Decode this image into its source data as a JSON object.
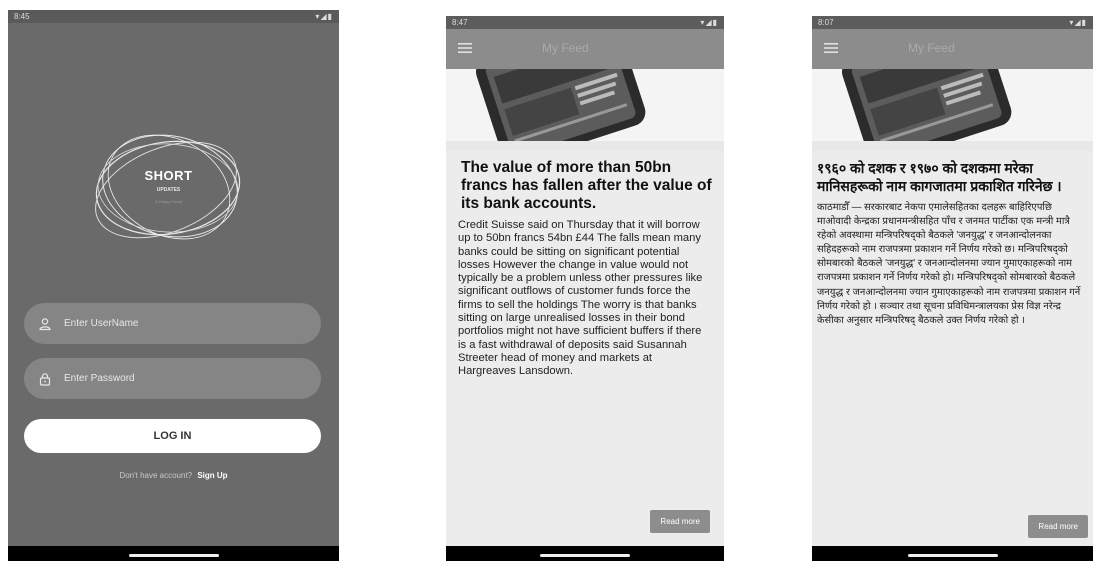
{
  "login": {
    "status_time": "8:45",
    "logo_title": "SHORT",
    "logo_subtitle": "UPDATES",
    "logo_tagline": "A Happy Portal",
    "username_placeholder": "Enter UserName",
    "password_placeholder": "Enter Password",
    "login_label": "LOG IN",
    "signup_prompt": "Don't have account?",
    "signup_link": "Sign Up"
  },
  "feed_english": {
    "status_time": "8:47",
    "app_title": "My Feed",
    "headline": "The value of more than 50bn francs has fallen after the value of its bank accounts.",
    "body": "Credit Suisse said on Thursday that it will borrow up to 50bn francs 54bn £44 The falls mean many banks could be sitting on significant potential losses However the change in value would not typically be a problem unless other pressures like significant outflows of customer funds force the firms to sell the holdings The worry is that banks sitting on large unrealised losses in their bond portfolios might not have sufficient buffers if there is a fast withdrawal of deposits said Susannah Streeter head of money and markets at Hargreaves Lansdown.",
    "read_more": "Read more"
  },
  "feed_nepali": {
    "status_time": "8:07",
    "app_title": "My Feed",
    "headline": "१९६० को दशक र १९७० को दशकमा मरेका मानिसहरूको नाम कागजातमा प्रकाशित गरिनेछ ।",
    "body": "काठमाडौँ — सरकारबाट नेकपा एमालेसहितका दलहरू बाहिरिएपछि माओवादी केन्द्रका प्रधानमन्त्रीसहित पाँच र जनमत पार्टीका एक मन्त्री मात्रै रहेको अवस्थामा मन्त्रिपरिषद्को बैठकले 'जनयुद्ध' र जनआन्दोलनका सहिदहरूको नाम राजपत्रमा प्रकाशन गर्ने निर्णय गरेको छ। मन्त्रिपरिषद्को सोमबारको बैठकले 'जनयुद्ध' र जनआन्दोलनमा ज्यान गुमाएकाहरूको नाम राजपत्रमा प्रकाशन गर्ने निर्णय गरेको हो। मन्त्रिपरिषद्को सोमबारको बैठकले जनयुद्ध र जनआन्दोलनमा ज्यान गुमाएकाहरूको नाम राजपत्रमा प्रकाशन गर्ने निर्णय गरेको हो । सञ्चार तथा सूचना प्रविधिमन्त्रालयका प्रेस विज्ञ नरेन्द्र केसीका अनुसार मन्त्रिपरिषद् बैठकले उक्त निर्णय गरेको हो ।",
    "read_more": "Read more"
  },
  "icons": [
    "user-icon",
    "lock-icon",
    "menu-icon",
    "wifi-icon",
    "signal-icon",
    "battery-icon"
  ],
  "colors": {
    "login_bg": "#6a6a6a",
    "field_bg": "#858585",
    "appbar": "#8c8c8c",
    "card_bg": "#ececec",
    "button": "#8d8d8d"
  }
}
